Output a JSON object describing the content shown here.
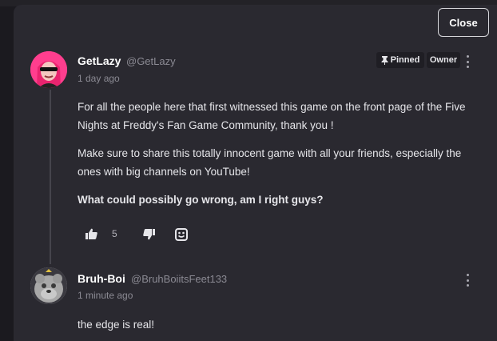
{
  "modal": {
    "close_label": "Close"
  },
  "comments": [
    {
      "username": "GetLazy",
      "handle": "@GetLazy",
      "timestamp": "1 day ago",
      "badges": {
        "pinned": "Pinned",
        "owner": "Owner"
      },
      "paragraphs": [
        "For all the people here that first witnessed this game on the front page of the Five Nights at Freddy's Fan Game Community, thank you !",
        "Make sure to share this totally innocent game with all your friends, especially the ones with big channels on YouTube!",
        "What could possibly go wrong, am I right guys?"
      ],
      "upvotes": "5"
    },
    {
      "username": "Bruh-Boi",
      "handle": "@BruhBoiitsFeet133",
      "timestamp": "1 minute ago",
      "paragraphs": [
        "the edge is real!"
      ]
    }
  ],
  "icons": {
    "thumbs_up": "thumbs-up-icon",
    "thumbs_down": "thumbs-down-icon",
    "reply": "reply-icon",
    "pin": "pin-icon",
    "more": "more-vertical-icon"
  },
  "colors": {
    "background": "#2a2930",
    "avatar1": "#ff3e8e",
    "badge_bg": "#1f1e24"
  }
}
